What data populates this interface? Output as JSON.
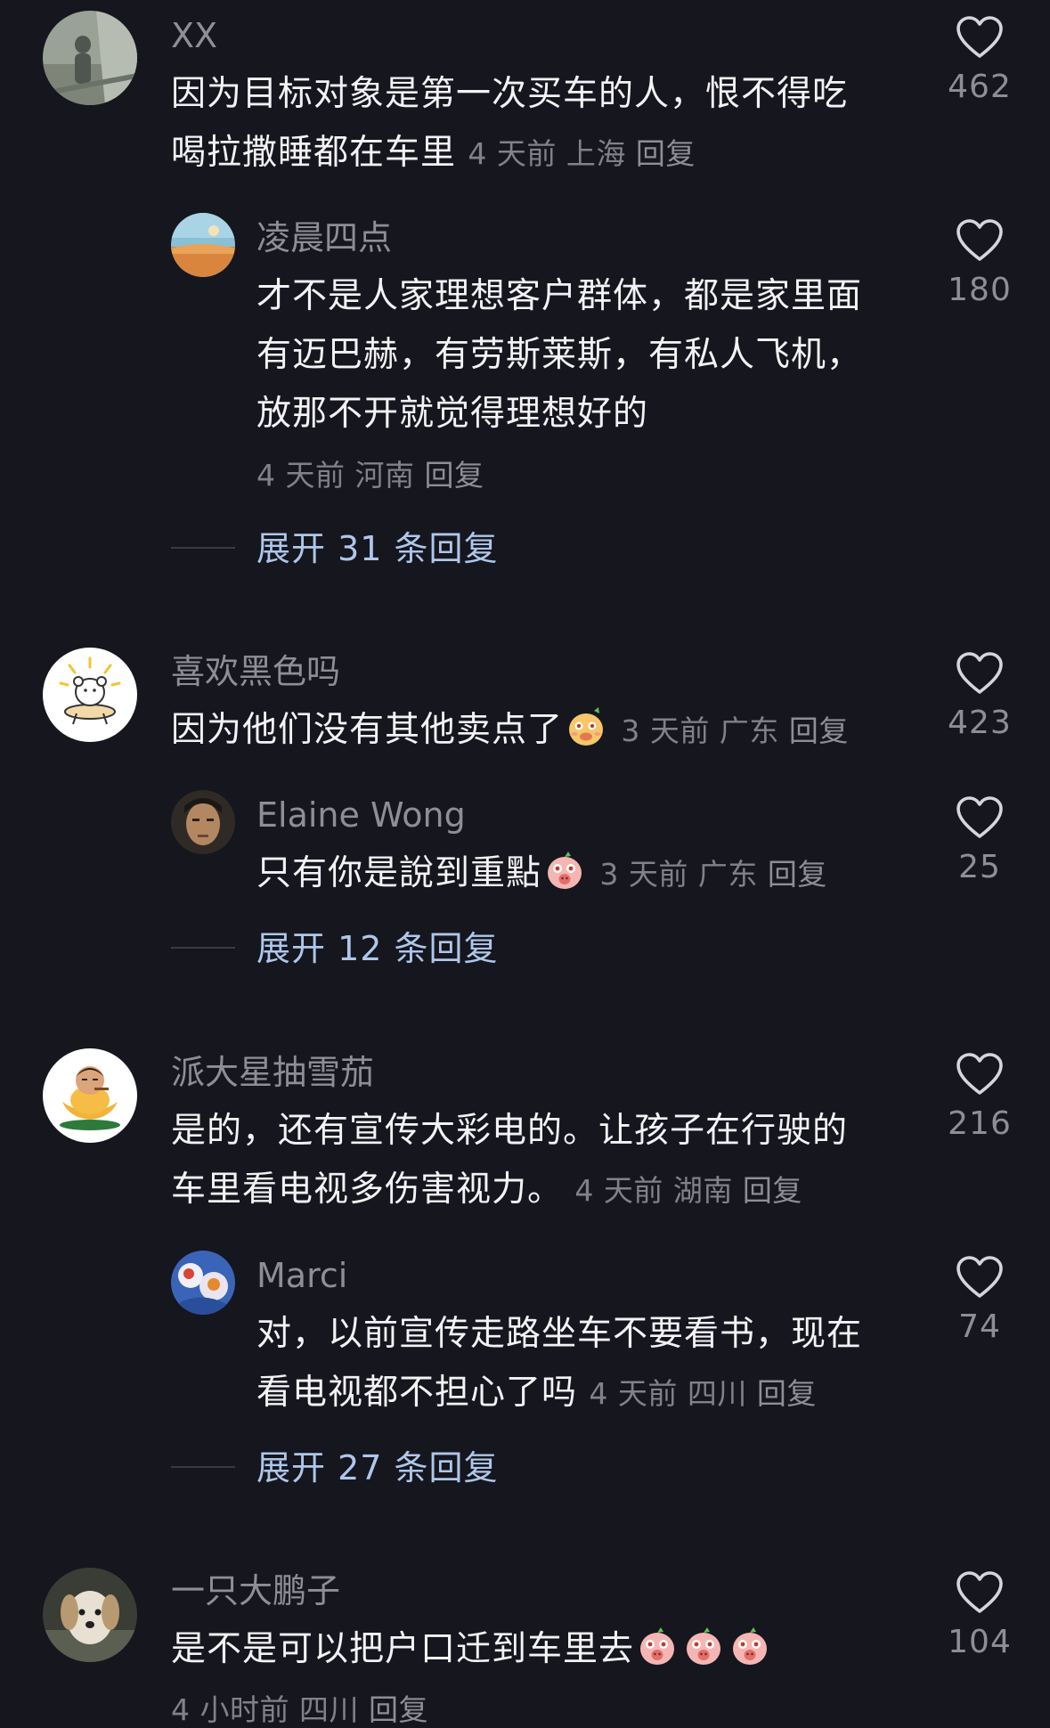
{
  "comments": [
    {
      "user": "XX",
      "text_line1": "因为目标对象是第一次买车的人，恨不得吃",
      "text_line2": "喝拉撒睡都在车里",
      "time": "4 天前",
      "location": "上海",
      "reply": "回复",
      "likes": "462",
      "sub": {
        "user": "凌晨四点",
        "text_line1": "才不是人家理想客户群体，都是家里面",
        "text_line2": "有迈巴赫，有劳斯莱斯，有私人飞机，",
        "text_line3": "放那不开就觉得理想好的",
        "time": "4 天前",
        "location": "河南",
        "reply": "回复",
        "likes": "180"
      },
      "expand": "展开 31 条回复"
    },
    {
      "user": "喜欢黑色吗",
      "text_line1": "因为他们没有其他卖点了",
      "time": "3 天前",
      "location": "广东",
      "reply": "回复",
      "likes": "423",
      "sub": {
        "user": "Elaine Wong",
        "text_line1": "只有你是說到重點",
        "time": "3 天前",
        "location": "广东",
        "reply": "回复",
        "likes": "25"
      },
      "expand": "展开 12 条回复"
    },
    {
      "user": "派大星抽雪茄",
      "text_line1": "是的，还有宣传大彩电的。让孩子在行驶的",
      "text_line2": "车里看电视多伤害视力。",
      "time": "4 天前",
      "location": "湖南",
      "reply": "回复",
      "likes": "216",
      "sub": {
        "user": "Marci",
        "text_line1": "对，以前宣传走路坐车不要看书，现在",
        "text_line2": "看电视都不担心了吗",
        "time": "4 天前",
        "location": "四川",
        "reply": "回复",
        "likes": "74"
      },
      "expand": "展开 27 条回复"
    },
    {
      "user": "一只大鹏子",
      "text_line1": "是不是可以把户口迁到车里去",
      "time": "4 小时前",
      "location": "四川",
      "reply": "回复",
      "likes": "104"
    }
  ],
  "icons": {
    "like": "heart-outline-icon",
    "emoji_sneer": "sneer-face-emoji",
    "emoji_pig": "pig-face-emoji"
  },
  "colors": {
    "background": "#16161e",
    "text": "#f3f3f5",
    "meta": "#81818b",
    "expand": "#aec7eb"
  }
}
